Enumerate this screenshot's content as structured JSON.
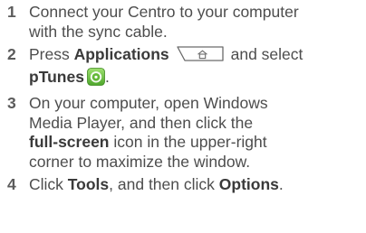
{
  "steps": [
    {
      "number": "1",
      "lines": [
        "Connect your Centro to your computer",
        "with the sync cable."
      ]
    },
    {
      "number": "2",
      "line1_pre": "Press ",
      "line1_bold": "Applications",
      "line1_post": "and select",
      "line2_bold": "pTunes",
      "line2_post": "."
    },
    {
      "number": "3",
      "line1": "On your computer, open Windows",
      "line2": "Media Player, and then click the",
      "line3_bold": "full-screen",
      "line3_post": " icon in the upper-right",
      "line4": "corner to maximize the window."
    },
    {
      "number": "4",
      "pre": "Click ",
      "bold1": "Tools",
      "mid": ", and then click ",
      "bold2": "Options",
      "post": "."
    }
  ],
  "icons": {
    "applications_key": "home-key-icon",
    "ptunes": "ptunes-app-icon",
    "ptunes_color": "#6fc23a"
  }
}
